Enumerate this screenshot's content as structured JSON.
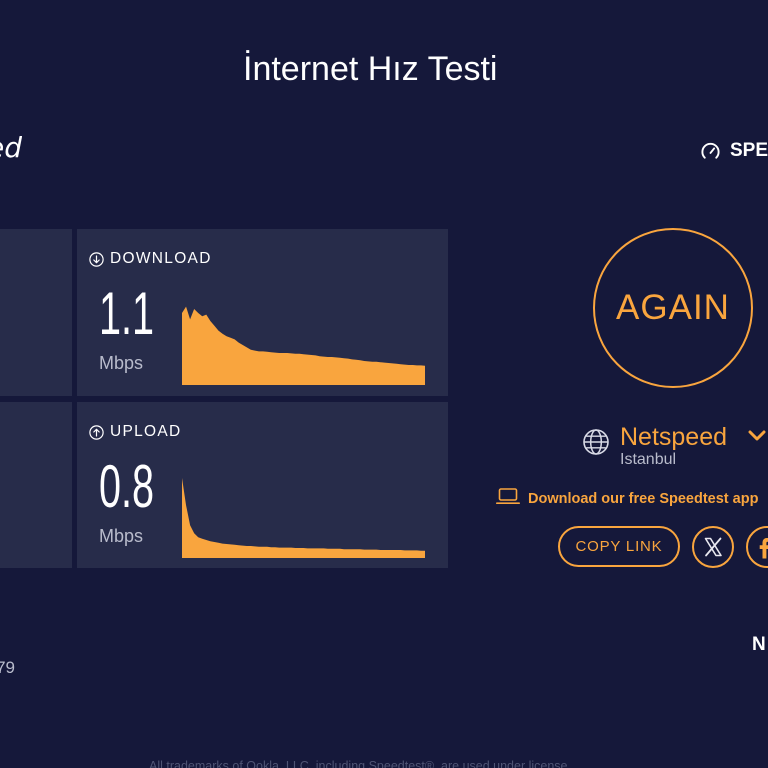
{
  "page": {
    "title": "İnternet Hız Testi"
  },
  "header": {
    "logo_fragment": "ed",
    "brand_fragment": "SPE"
  },
  "results": {
    "download": {
      "label": "DOWNLOAD",
      "value": "1.1",
      "unit": "Mbps",
      "graph_levels": [
        0.9,
        0.98,
        0.82,
        0.95,
        0.9,
        0.86,
        0.88,
        0.8,
        0.74,
        0.68,
        0.64,
        0.61,
        0.59,
        0.57,
        0.53,
        0.5,
        0.47,
        0.44,
        0.43,
        0.42,
        0.42,
        0.415,
        0.41,
        0.405,
        0.4,
        0.4,
        0.4,
        0.395,
        0.39,
        0.39,
        0.385,
        0.38,
        0.375,
        0.37,
        0.36,
        0.355,
        0.35,
        0.35,
        0.345,
        0.34,
        0.335,
        0.33,
        0.32,
        0.315,
        0.31,
        0.3,
        0.295,
        0.29,
        0.29,
        0.285,
        0.28,
        0.275,
        0.27,
        0.265,
        0.26,
        0.255,
        0.25,
        0.25,
        0.245,
        0.245,
        0.24
      ]
    },
    "upload": {
      "label": "UPLOAD",
      "value": "0.8",
      "unit": "Mbps",
      "graph_levels": [
        1.0,
        0.66,
        0.41,
        0.31,
        0.26,
        0.24,
        0.225,
        0.21,
        0.2,
        0.19,
        0.18,
        0.175,
        0.17,
        0.165,
        0.16,
        0.155,
        0.15,
        0.15,
        0.145,
        0.14,
        0.14,
        0.14,
        0.135,
        0.135,
        0.13,
        0.13,
        0.13,
        0.13,
        0.125,
        0.125,
        0.125,
        0.12,
        0.12,
        0.12,
        0.12,
        0.12,
        0.115,
        0.115,
        0.115,
        0.115,
        0.11,
        0.11,
        0.11,
        0.11,
        0.11,
        0.105,
        0.105,
        0.105,
        0.105,
        0.1,
        0.1,
        0.1,
        0.1,
        0.1,
        0.1,
        0.095,
        0.095,
        0.095,
        0.095,
        0.09,
        0.09
      ]
    }
  },
  "actions": {
    "again_label": "AGAIN",
    "copy_link_label": "COPY LINK"
  },
  "server": {
    "provider": "Netspeed",
    "location": "Istanbul"
  },
  "app_promo": {
    "text": "Download our free Speedtest app"
  },
  "fragments": {
    "right_heading": "N",
    "left_value": "79"
  },
  "footer": {
    "text": "All trademarks of Ookla, LLC, including Speedtest®, are used under license."
  },
  "colors": {
    "background": "#15183a",
    "card": "#272c4a",
    "accent": "#f9a53e",
    "text": "#ffffff",
    "muted": "#b9bccc"
  },
  "icons": {
    "brand": "gauge-icon",
    "download": "download-icon",
    "upload": "upload-icon",
    "server": "globe-icon",
    "server_menu": "chevron-down-icon",
    "app_promo": "laptop-icon",
    "share_x": "x-logo-icon",
    "share_facebook": "facebook-icon"
  }
}
